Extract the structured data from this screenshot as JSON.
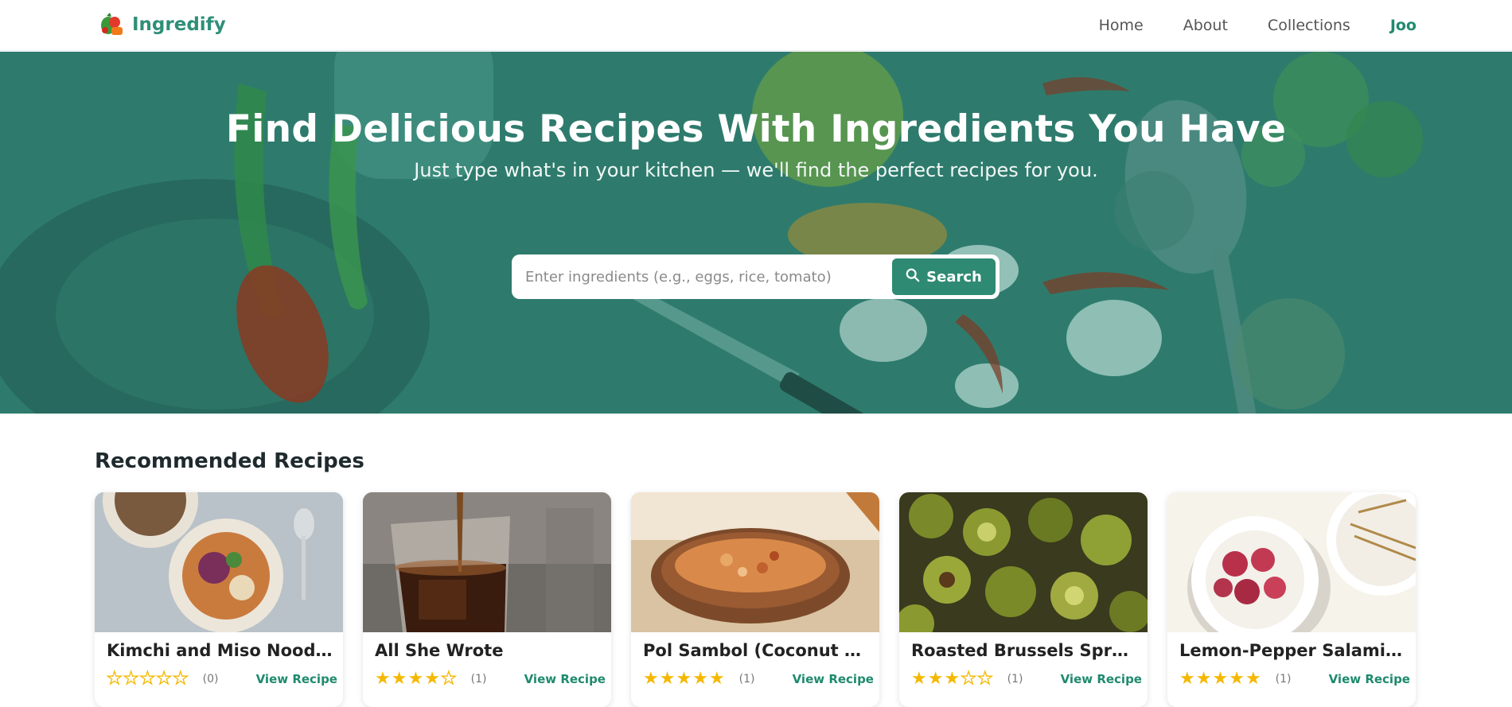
{
  "header": {
    "brand": "Ingredify",
    "nav": [
      {
        "label": "Home"
      },
      {
        "label": "About"
      },
      {
        "label": "Collections"
      },
      {
        "label": "Joo"
      }
    ]
  },
  "hero": {
    "title": "Find Delicious Recipes With Ingredients You Have",
    "subtitle": "Just type what's in your kitchen — we'll find the perfect recipes for you.",
    "search_placeholder": "Enter ingredients (e.g., eggs, rice, tomato)",
    "search_button": "Search"
  },
  "section": {
    "title": "Recommended Recipes"
  },
  "recipes": [
    {
      "title": "Kimchi and Miso Noodle ...",
      "rating": 0,
      "count": "(0)",
      "link": "View Recipe"
    },
    {
      "title": "All She Wrote",
      "rating": 4,
      "count": "(1)",
      "link": "View Recipe"
    },
    {
      "title": "Pol Sambol (Coconut Reli...",
      "rating": 5,
      "count": "(1)",
      "link": "View Recipe"
    },
    {
      "title": "Roasted Brussels Sprouts ...",
      "rating": 3,
      "count": "(1)",
      "link": "View Recipe"
    },
    {
      "title": "Lemon-Pepper Salami Bit...",
      "rating": 5,
      "count": "(1)",
      "link": "View Recipe"
    }
  ],
  "colors": {
    "brand": "#2f8f78",
    "hero_overlay": "#2e7b6d",
    "accent": "#1f8a6e",
    "star": "#f5b800"
  }
}
